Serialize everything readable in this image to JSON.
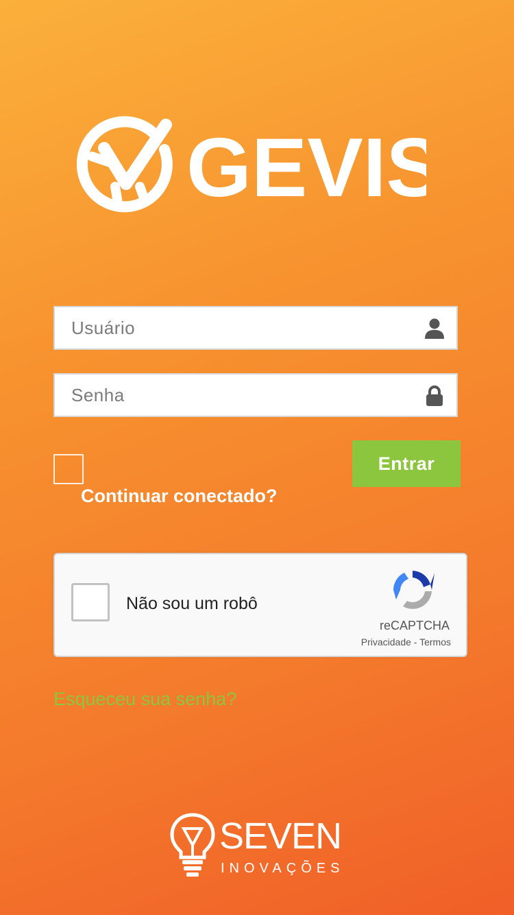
{
  "app": {
    "brand": "GEVIS",
    "accent_color": "#f47a2c",
    "button_color": "#8cc63f"
  },
  "form": {
    "username": {
      "placeholder": "Usuário",
      "value": "",
      "icon": "user-icon"
    },
    "password": {
      "placeholder": "Senha",
      "value": "",
      "icon": "lock-icon"
    },
    "remember": {
      "label": "Continuar conectado?",
      "checked": false
    },
    "submit_label": "Entrar"
  },
  "captcha": {
    "label": "Não sou um robô",
    "brand": "reCAPTCHA",
    "privacy_label": "Privacidade",
    "separator": " - ",
    "terms_label": "Termos",
    "checked": false
  },
  "forgot_password_label": "Esqueceu sua senha?",
  "footer": {
    "brand": "SEVEN",
    "subtitle": "INOVAÇÕES"
  }
}
